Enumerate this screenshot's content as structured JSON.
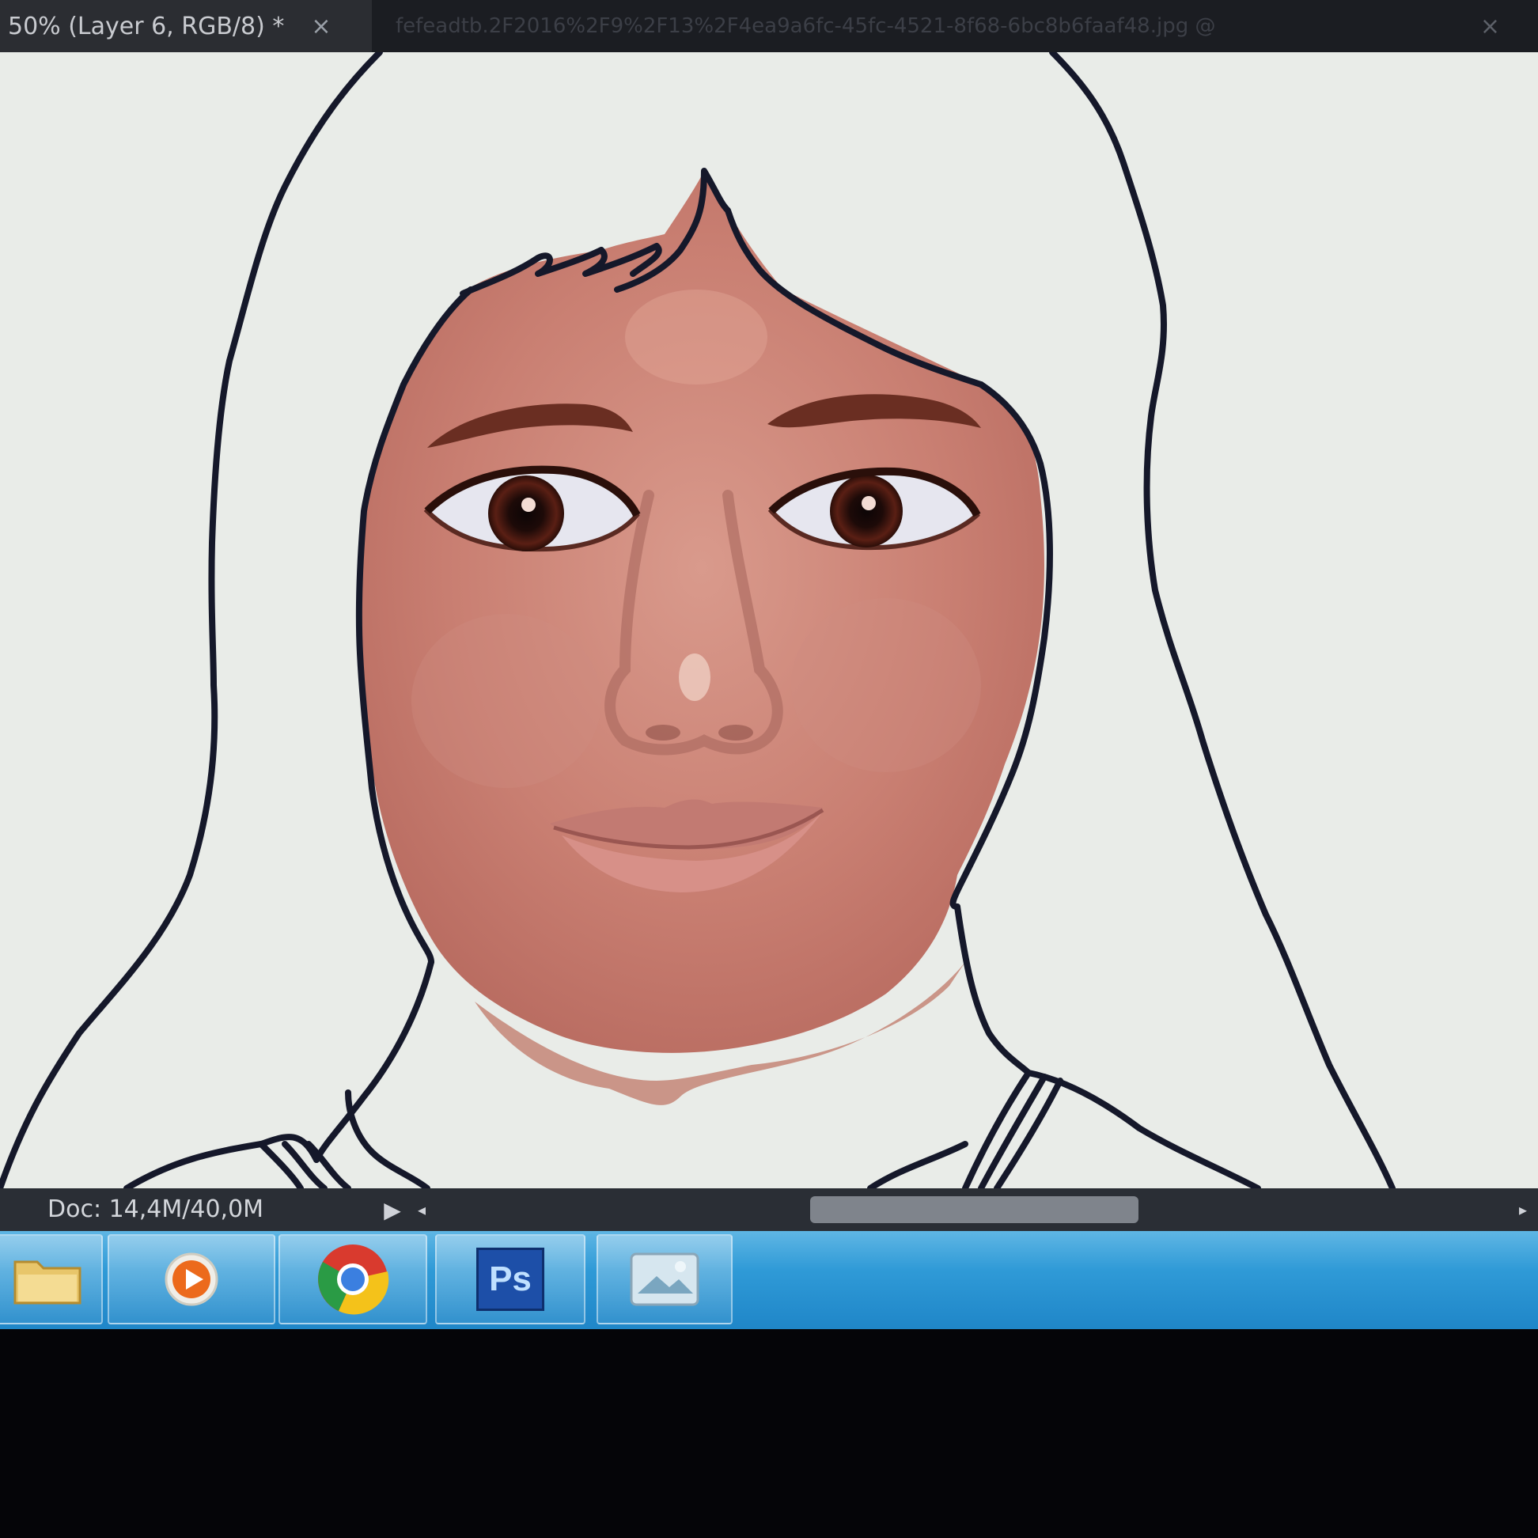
{
  "document_tab": {
    "label": "50% (Layer 6, RGB/8) *",
    "close_glyph": "×"
  },
  "second_tab": {
    "label": "fefeadtb.2F2016%2F9%2F13%2F4ea9a6fc-45fc-4521-8f68-6bc8b6faaf48.jpg @",
    "close_glyph": "×"
  },
  "status": {
    "doc_info": "Doc: 14,4M/40,0M",
    "arrow_glyph": "▶",
    "scroll_left_glyph": "◂",
    "scroll_right_glyph": "▸"
  },
  "taskbar": {
    "apps": [
      {
        "name": "File Explorer",
        "icon": "folder-icon"
      },
      {
        "name": "Media Player",
        "icon": "media-player-icon"
      },
      {
        "name": "Google Chrome",
        "icon": "chrome-icon"
      },
      {
        "name": "Adobe Photoshop",
        "icon": "photoshop-icon",
        "label": "Ps"
      },
      {
        "name": "Windows Photo Viewer",
        "icon": "photo-viewer-icon"
      }
    ]
  },
  "colors": {
    "canvas_bg": "#e9ece8",
    "skin": "#c97f72",
    "outline": "#15182a",
    "taskbar": "#2f9ad7",
    "photoshop_blue": "#1d4fa8"
  }
}
